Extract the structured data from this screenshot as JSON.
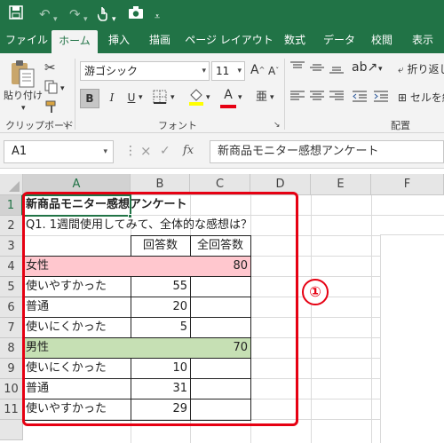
{
  "quick_access": {
    "save_icon": "save-icon",
    "undo_icon": "undo-icon",
    "redo_icon": "redo-icon",
    "touch_icon": "touch-mode-icon",
    "camera_icon": "camera-icon",
    "customize_icon": "customize-icon"
  },
  "tabs": [
    "ファイル",
    "ホーム",
    "挿入",
    "描画",
    "ページ レイアウト",
    "数式",
    "データ",
    "校閲",
    "表示"
  ],
  "ribbon": {
    "clipboard": {
      "paste_label": "貼り付け",
      "group_label": "クリップボード"
    },
    "font": {
      "font_name": "游ゴシック",
      "font_size": "11",
      "grow": "A",
      "shrink": "A",
      "bold": "B",
      "italic": "I",
      "underline": "U",
      "font_color": "A",
      "phonetic": "亜",
      "group_label": "フォント"
    },
    "alignment": {
      "wrap_label": "折り返し",
      "merge_label": "セルを結",
      "group_label": "配置"
    }
  },
  "formula_bar": {
    "name_box": "A1",
    "fx": "fx",
    "cancel": "×",
    "enter": "✓",
    "formula": "新商品モニター感想アンケート"
  },
  "columns": [
    "A",
    "B",
    "C",
    "D",
    "E",
    "F"
  ],
  "rows": [
    "1",
    "2",
    "3",
    "4",
    "5",
    "6",
    "7",
    "8",
    "9",
    "10",
    "11"
  ],
  "cells": {
    "a1": "新商品モニター感想アンケート",
    "a2": "Q1. 1週間使用してみて、全体的な感想は？",
    "b3": "回答数",
    "c3": "全回答数",
    "a4": "女性",
    "c4": "80",
    "a5": "使いやすかった",
    "b5": "55",
    "a6": "普通",
    "b6": "20",
    "a7": "使いにくかった",
    "b7": "5",
    "a8": "男性",
    "c8": "70",
    "a9": "使いにくかった",
    "b9": "10",
    "a10": "普通",
    "b10": "31",
    "a11": "使いやすかった",
    "b11": "29"
  },
  "annotation": {
    "marker": "①"
  },
  "colors": {
    "excel_green": "#217346",
    "female_fill": "#ffc7ce",
    "male_fill": "#c6e0b4",
    "highlight_red": "#e60012"
  }
}
